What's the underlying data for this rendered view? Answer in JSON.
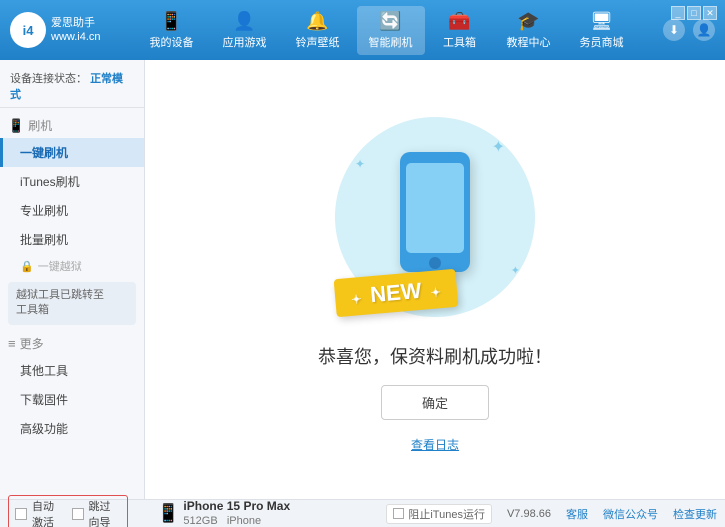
{
  "app": {
    "logo_text": "i4",
    "logo_subtext": "爱思助手\nwww.i4.cn"
  },
  "nav": {
    "tabs": [
      {
        "id": "my-device",
        "label": "我的设备",
        "icon": "📱"
      },
      {
        "id": "apps-games",
        "label": "应用游戏",
        "icon": "👤"
      },
      {
        "id": "ringtones",
        "label": "铃声壁纸",
        "icon": "🔔"
      },
      {
        "id": "smart-flash",
        "label": "智能刷机",
        "icon": "🔄",
        "active": true
      },
      {
        "id": "toolbox",
        "label": "工具箱",
        "icon": "🧰"
      },
      {
        "id": "tutorials",
        "label": "教程中心",
        "icon": "🎓"
      },
      {
        "id": "business",
        "label": "务员商城",
        "icon": "🖥"
      }
    ]
  },
  "header_actions": {
    "download_icon": "⬇",
    "user_icon": "👤"
  },
  "sidebar": {
    "status_label": "设备连接状态：",
    "status_value": "正常模式",
    "sections": [
      {
        "id": "flash",
        "icon": "📱",
        "label": "刷机",
        "items": [
          {
            "id": "one-click-flash",
            "label": "一键刷机",
            "active": true
          },
          {
            "id": "itunes-flash",
            "label": "iTunes刷机"
          },
          {
            "id": "pro-flash",
            "label": "专业刷机"
          },
          {
            "id": "batch-flash",
            "label": "批量刷机"
          }
        ]
      },
      {
        "id": "one-click-jailbreak",
        "icon": "🔒",
        "label": "一键越狱",
        "disabled": true,
        "note": "越狱工具已跳转至\n工具箱"
      }
    ],
    "more_section": {
      "label": "更多",
      "items": [
        {
          "id": "other-tools",
          "label": "其他工具"
        },
        {
          "id": "download-firmware",
          "label": "下载固件"
        },
        {
          "id": "advanced",
          "label": "高级功能"
        }
      ]
    },
    "auto_activate_label": "自动激活",
    "guided_activate_label": "跳过向导"
  },
  "content": {
    "success_title": "恭喜您，保资料刷机成功啦！",
    "confirm_button": "确定",
    "view_log_link": "查看日志",
    "new_badge": "NEW"
  },
  "device": {
    "name": "iPhone 15 Pro Max",
    "storage": "512GB",
    "type": "iPhone",
    "icon": "📱"
  },
  "bottom_bar": {
    "itunes_label": "阻止iTunes运行",
    "version": "V7.98.66",
    "links": [
      "客服",
      "微信公众号",
      "检查更新"
    ]
  }
}
